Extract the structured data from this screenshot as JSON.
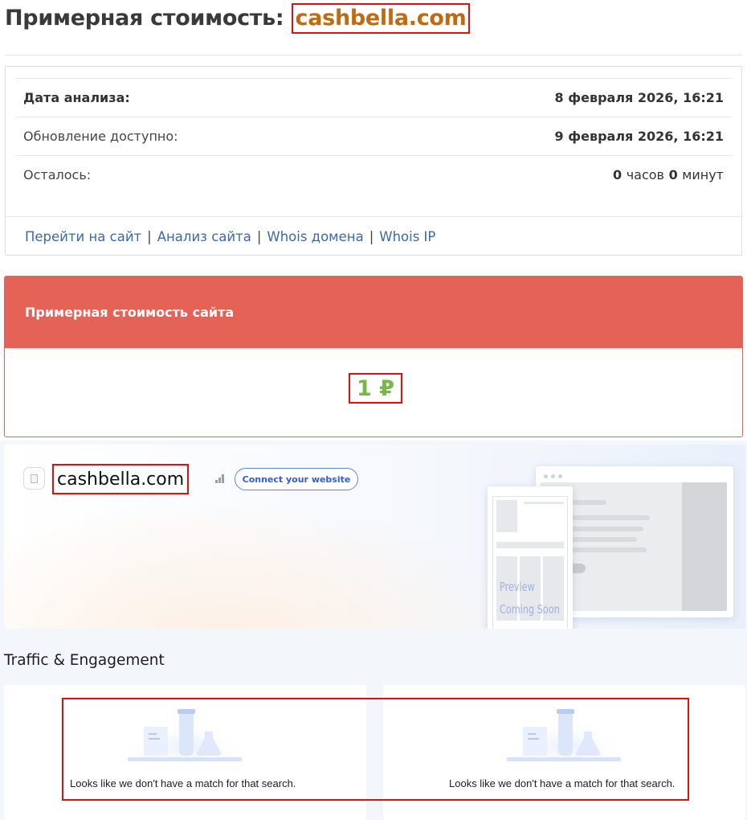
{
  "header": {
    "title_prefix": "Примерная стоимость:",
    "domain": "cashbella.com"
  },
  "info": {
    "rows": [
      {
        "label": "Дата анализа:",
        "value": "8 февраля 2026, 16:21"
      },
      {
        "label": "Обновление доступно:",
        "value": "9 февраля 2026, 16:21"
      },
      {
        "label": "Осталось:",
        "hours": "0",
        "hours_unit": "часов",
        "minutes": "0",
        "minutes_unit": "минут"
      }
    ],
    "links": [
      "Перейти на сайт",
      "Анализ сайта",
      "Whois домена",
      "Whois IP"
    ],
    "separator": "|"
  },
  "cost": {
    "heading": "Примерная стоимость сайта",
    "value": "1 ₽"
  },
  "similarweb": {
    "site": "cashbella.com",
    "connect_label": "Connect your website",
    "preview_line1": "Preview",
    "preview_line2": "Coming Soon",
    "section_title": "Traffic & Engagement",
    "no_match_left": "Looks like we don't have a match for that search.",
    "no_match_right": "Looks like we don't have a match for that search."
  },
  "colors": {
    "accent_red": "#e46356",
    "value_green": "#7ab648",
    "domain_orange": "#c06a12",
    "link_blue": "#3a6aa3",
    "highlight_red": "#e01010"
  }
}
